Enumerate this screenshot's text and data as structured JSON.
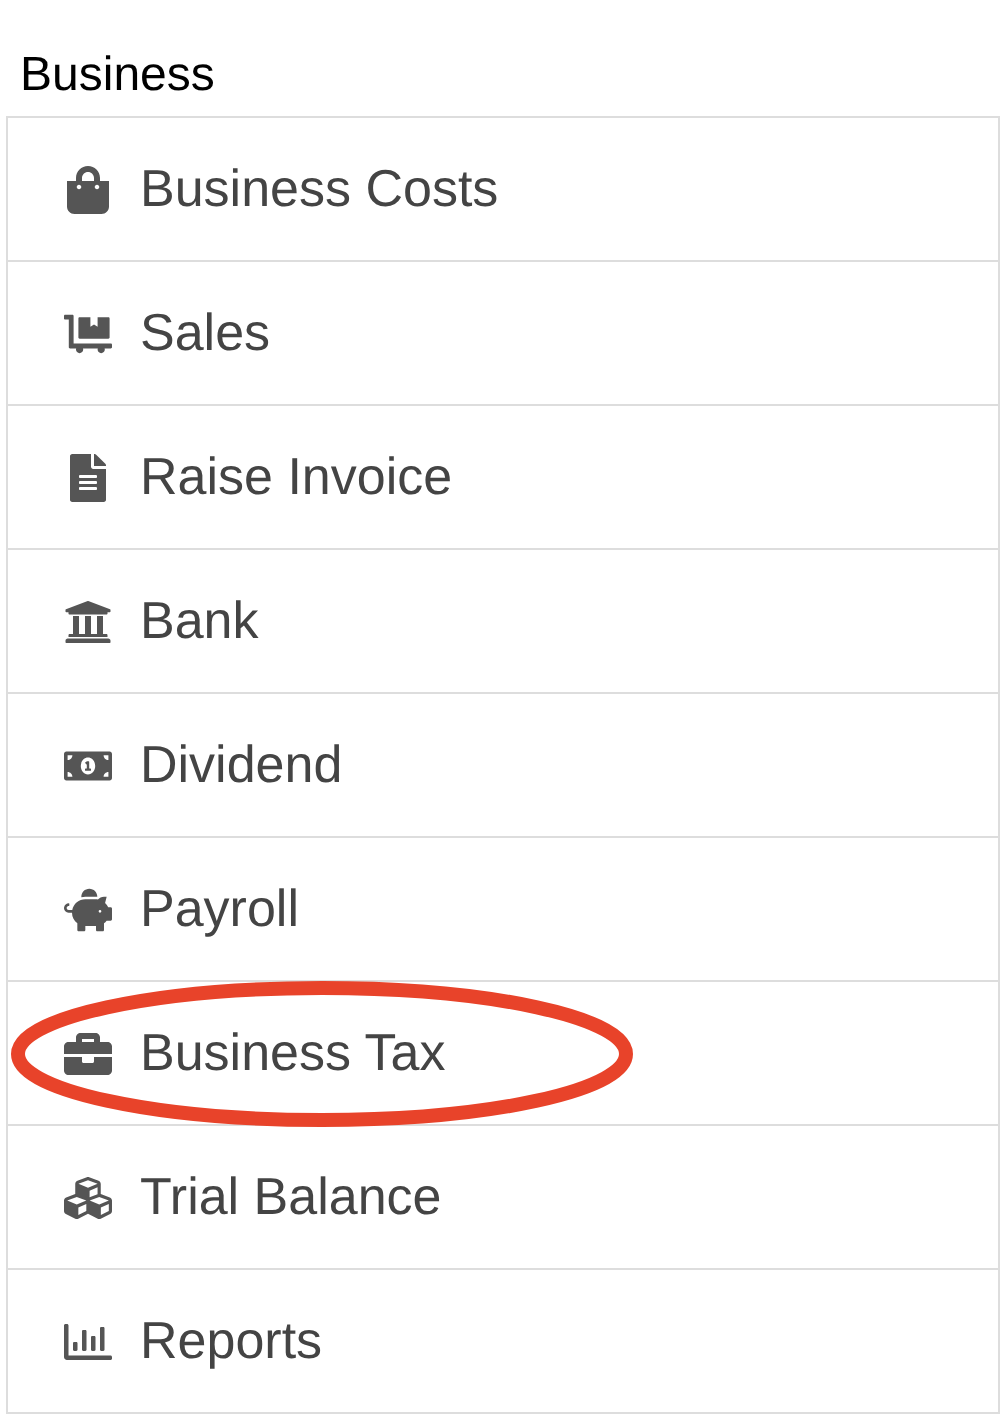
{
  "section_title": "Business",
  "items": [
    {
      "label": "Business Costs",
      "circled": false
    },
    {
      "label": "Sales",
      "circled": false
    },
    {
      "label": "Raise Invoice",
      "circled": false
    },
    {
      "label": "Bank",
      "circled": false
    },
    {
      "label": "Dividend",
      "circled": false
    },
    {
      "label": "Payroll",
      "circled": false
    },
    {
      "label": "Business Tax",
      "circled": true
    },
    {
      "label": "Trial Balance",
      "circled": false
    },
    {
      "label": "Reports",
      "circled": false
    }
  ]
}
